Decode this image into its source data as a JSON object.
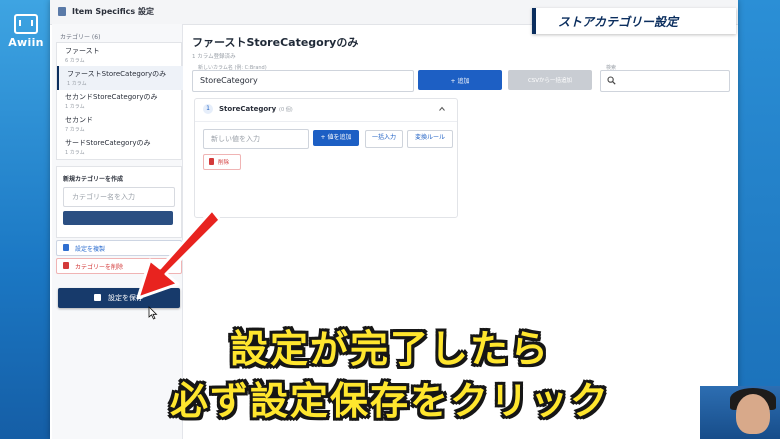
{
  "brand": {
    "logo_text": "Awiin"
  },
  "window": {
    "title": "Item Specifics 設定"
  },
  "banner": {
    "text": "ストアカテゴリー設定"
  },
  "sidebar": {
    "category_header": "カテゴリー (6)",
    "categories": [
      {
        "name": "ファースト",
        "sub": "6 カラム",
        "active": false
      },
      {
        "name": "ファーストStoreCategoryのみ",
        "sub": "1 カラム",
        "active": true
      },
      {
        "name": "セカンドStoreCategoryのみ",
        "sub": "1 カラム",
        "active": false
      },
      {
        "name": "セカンド",
        "sub": "7 カラム",
        "active": false
      },
      {
        "name": "サードStoreCategoryのみ",
        "sub": "1 カラム",
        "active": false
      }
    ],
    "new_category": {
      "title": "新規カテゴリーを作成",
      "placeholder": "カテゴリー名を入力"
    },
    "copy_button": "設定を複製",
    "delete_button": "カテゴリーを削除",
    "save_button": "設定を保存"
  },
  "main": {
    "title": "ファーストStoreCategoryのみ",
    "subtitle": "1 カラム登録済み",
    "new_column_label": "新しいカラム名 (例: C:Brand)",
    "new_column_value": "StoreCategory",
    "add_button": "+ 追加",
    "disabled_button": "CSVから一括追加",
    "search_label": "検索",
    "card": {
      "index": "1",
      "name": "StoreCategory",
      "count": "(0 個)",
      "value_placeholder": "新しい値を入力",
      "add_value_button": "+ 値を追加",
      "bulk_button": "一括入力",
      "rule_button": "変換ルール",
      "delete_button": "削除"
    }
  },
  "subtitles": {
    "line1": "設定が完了したら",
    "line2": "必ず設定保存をクリック"
  },
  "colors": {
    "accent": "#1d5fc4",
    "save": "#173a6b",
    "arrow": "#e8231f",
    "subtitle": "#ffe62e"
  }
}
